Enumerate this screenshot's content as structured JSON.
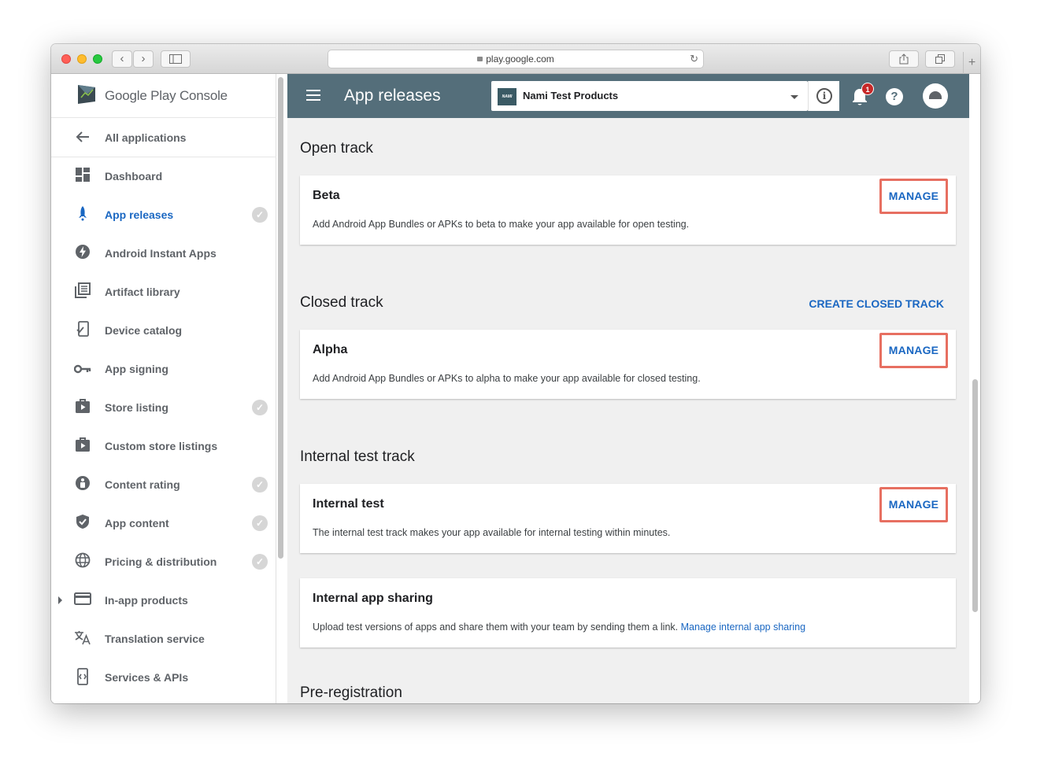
{
  "browser": {
    "url": "play.google.com",
    "back_icon": "chevron-left",
    "forward_icon": "chevron-right",
    "reload_icon": "reload",
    "share_icon": "share",
    "tabs_icon": "tabs",
    "new_tab": "+"
  },
  "sidebar": {
    "logo_brand": "Google Play",
    "logo_product": "Console",
    "back_label": "All applications",
    "items": [
      {
        "label": "Dashboard",
        "icon": "dashboard-icon",
        "check": false,
        "active": false
      },
      {
        "label": "App releases",
        "icon": "rocket-icon",
        "check": true,
        "active": true
      },
      {
        "label": "Android Instant Apps",
        "icon": "bolt-icon",
        "check": false,
        "active": false
      },
      {
        "label": "Artifact library",
        "icon": "library-icon",
        "check": false,
        "active": false
      },
      {
        "label": "Device catalog",
        "icon": "device-icon",
        "check": false,
        "active": false
      },
      {
        "label": "App signing",
        "icon": "key-icon",
        "check": false,
        "active": false
      },
      {
        "label": "Store listing",
        "icon": "store-icon",
        "check": true,
        "active": false
      },
      {
        "label": "Custom store listings",
        "icon": "store-icon",
        "check": false,
        "active": false
      },
      {
        "label": "Content rating",
        "icon": "rating-icon",
        "check": true,
        "active": false
      },
      {
        "label": "App content",
        "icon": "shield-icon",
        "check": true,
        "active": false
      },
      {
        "label": "Pricing & distribution",
        "icon": "globe-icon",
        "check": true,
        "active": false
      },
      {
        "label": "In-app products",
        "icon": "card-icon",
        "check": false,
        "active": false
      },
      {
        "label": "Translation service",
        "icon": "translate-icon",
        "check": false,
        "active": false
      },
      {
        "label": "Services & APIs",
        "icon": "api-icon",
        "check": false,
        "active": false
      }
    ]
  },
  "header": {
    "title": "App releases",
    "app_name": "Nami Test Products",
    "app_thumb_text": "NAMI",
    "notification_count": "1",
    "help_glyph": "?",
    "info_glyph": "i"
  },
  "sections": {
    "open": {
      "title": "Open track",
      "card": {
        "title": "Beta",
        "desc": "Add Android App Bundles or APKs to beta to make your app available for open testing.",
        "button": "MANAGE"
      }
    },
    "closed": {
      "title": "Closed track",
      "action": "CREATE CLOSED TRACK",
      "card": {
        "title": "Alpha",
        "desc": "Add Android App Bundles or APKs to alpha to make your app available for closed testing.",
        "button": "MANAGE"
      }
    },
    "internal": {
      "title": "Internal test track",
      "card": {
        "title": "Internal test",
        "desc": "The internal test track makes your app available for internal testing within minutes.",
        "button": "MANAGE"
      },
      "sharing": {
        "title": "Internal app sharing",
        "desc": "Upload test versions of apps and share them with your team by sending them a link.",
        "link": "Manage internal app sharing"
      }
    },
    "prereg": {
      "title": "Pre-registration"
    }
  },
  "colors": {
    "accent": "#1a67c2",
    "topbar": "#546e7a",
    "highlight": "#e76f61"
  }
}
